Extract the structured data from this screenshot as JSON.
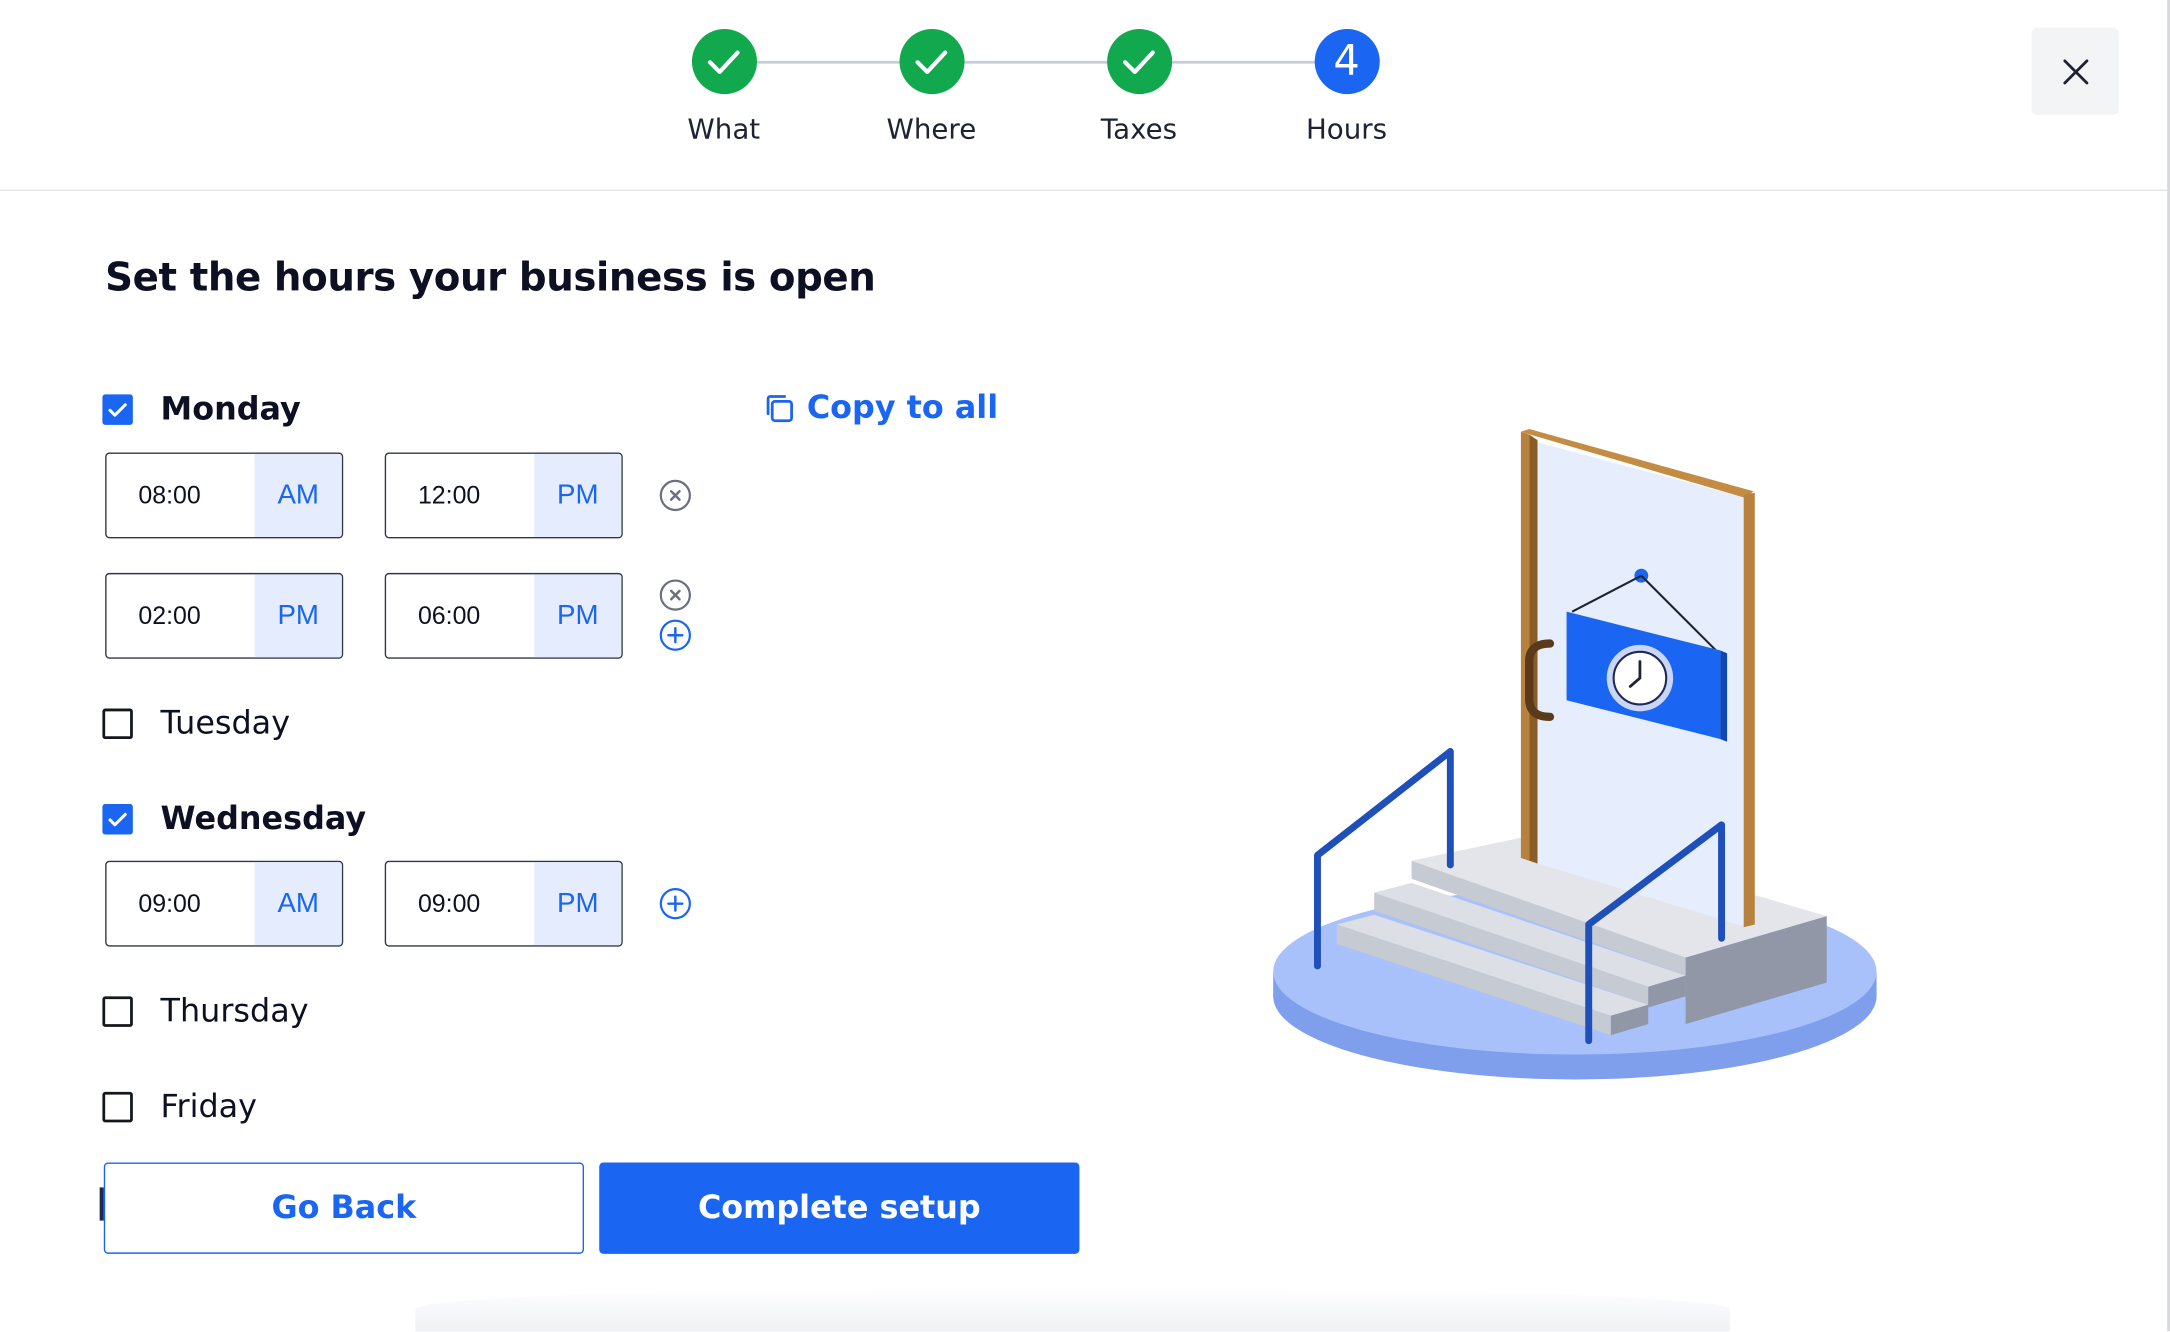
{
  "stepper": {
    "steps": [
      {
        "label": "What",
        "status": "done"
      },
      {
        "label": "Where",
        "status": "done"
      },
      {
        "label": "Taxes",
        "status": "done"
      },
      {
        "label": "Hours",
        "status": "active",
        "number": "4"
      }
    ]
  },
  "close_icon": "close-icon",
  "page_title": "Set the hours your business is open",
  "copy_to_all": "Copy to all",
  "days": [
    {
      "name": "Monday",
      "checked": true,
      "ranges": [
        {
          "from": "08:00",
          "from_period": "AM",
          "to": "12:00",
          "to_period": "PM"
        },
        {
          "from": "02:00",
          "from_period": "PM",
          "to": "06:00",
          "to_period": "PM"
        }
      ]
    },
    {
      "name": "Tuesday",
      "checked": false,
      "ranges": []
    },
    {
      "name": "Wednesday",
      "checked": true,
      "ranges": [
        {
          "from": "09:00",
          "from_period": "AM",
          "to": "09:00",
          "to_period": "PM"
        }
      ]
    },
    {
      "name": "Thursday",
      "checked": false,
      "ranges": []
    },
    {
      "name": "Friday",
      "checked": false,
      "ranges": []
    }
  ],
  "buttons": {
    "back": "Go Back",
    "complete": "Complete setup"
  },
  "colors": {
    "accent": "#1a66f3",
    "success": "#12a94e",
    "period_bg": "#e4ecfd"
  }
}
